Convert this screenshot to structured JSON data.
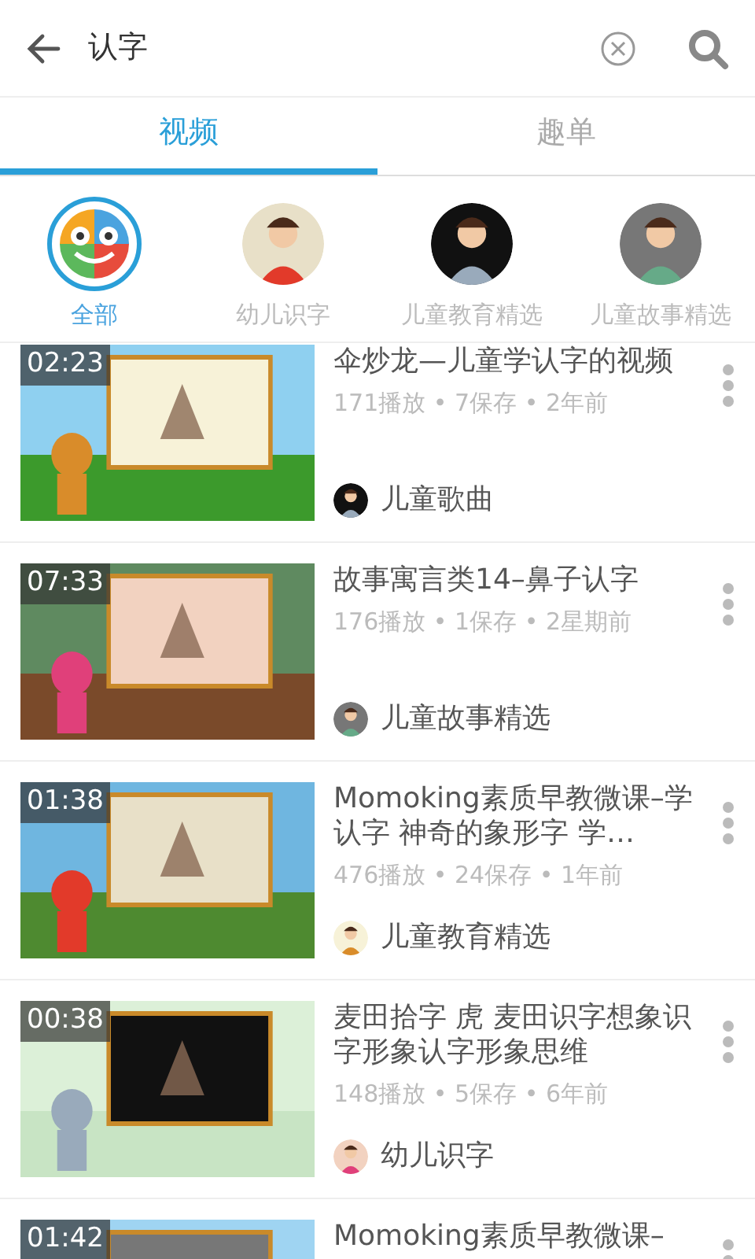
{
  "search": {
    "value": "认字"
  },
  "tabs": [
    {
      "label": "视频",
      "selected": true
    },
    {
      "label": "趣单",
      "selected": false
    }
  ],
  "categories": [
    {
      "label": "全部",
      "selected": true,
      "kind": "logo"
    },
    {
      "label": "幼儿识字",
      "selected": false,
      "kind": "picture"
    },
    {
      "label": "儿童教育精选",
      "selected": false,
      "kind": "picture"
    },
    {
      "label": "儿童故事精选",
      "selected": false,
      "kind": "picture"
    }
  ],
  "videos": [
    {
      "duration": "02:23",
      "title": "伞炒龙—儿童学认字的视频",
      "meta": "171播放 • 7保存 • 2年前",
      "channel": "儿童歌曲"
    },
    {
      "duration": "07:33",
      "title": "故事寓言类14–鼻子认字",
      "meta": "176播放 • 1保存 • 2星期前",
      "channel": "儿童故事精选"
    },
    {
      "duration": "01:38",
      "title": "Momoking素质早教微课–学认字 神奇的象形字 学…",
      "meta": "476播放 • 24保存 • 1年前",
      "channel": "儿童教育精选"
    },
    {
      "duration": "00:38",
      "title": "麦田拾字 虎 麦田识字想象识字形象认字形象思维",
      "meta": "148播放 • 5保存 • 6年前",
      "channel": "幼儿识字"
    },
    {
      "duration": "01:42",
      "title": "Momoking素质早教微课–"
    }
  ]
}
